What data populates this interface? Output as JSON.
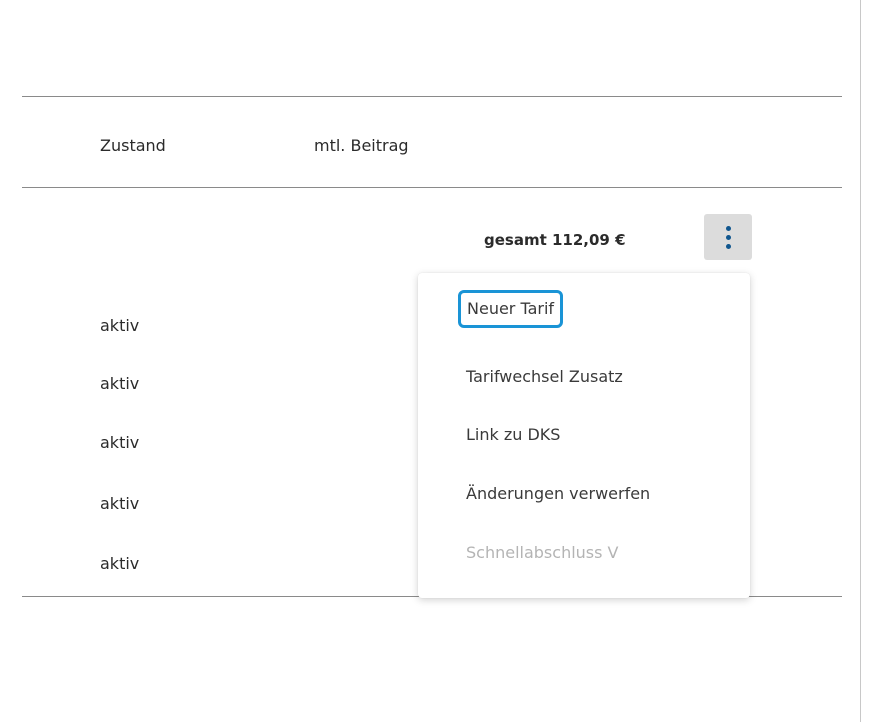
{
  "table": {
    "columns": {
      "status": "Zustand",
      "monthly_fee": "mtl. Beitrag"
    },
    "total_label": "gesamt 112,09 €",
    "rows": [
      {
        "status": "aktiv"
      },
      {
        "status": "aktiv"
      },
      {
        "status": "aktiv"
      },
      {
        "status": "aktiv"
      },
      {
        "status": "aktiv"
      }
    ]
  },
  "actions_button": {
    "icon": "kebab-vertical-icon",
    "icon_color": "#10568e",
    "background": "#dcdcdc"
  },
  "menu": {
    "items": [
      {
        "label": "Neuer Tarif",
        "state": "focused"
      },
      {
        "label": "Tarifwechsel Zusatz",
        "state": "enabled"
      },
      {
        "label": "Link zu DKS",
        "state": "enabled"
      },
      {
        "label": "Änderungen verwerfen",
        "state": "enabled"
      },
      {
        "label": "Schnellabschluss V",
        "state": "disabled"
      }
    ],
    "focus_color": "#1a94d6"
  }
}
